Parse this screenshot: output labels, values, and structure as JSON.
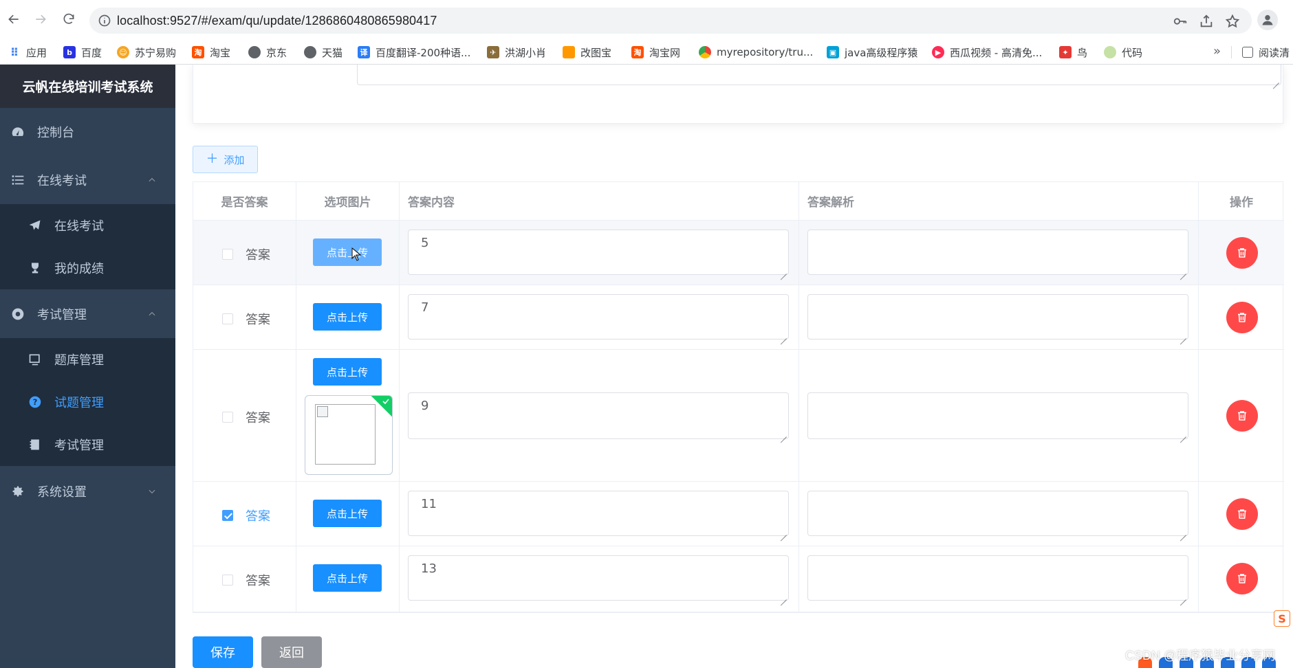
{
  "browser": {
    "url": "localhost:9527/#/exam/qu/update/1286860480865980417",
    "bookmarks": [
      {
        "label": "应用",
        "icon": "apps-grid-icon",
        "color": "#4285f4"
      },
      {
        "label": "百度",
        "icon": "baidu-paw-icon",
        "color": "#2932e1"
      },
      {
        "label": "苏宁易购",
        "icon": "suning-icon",
        "color": "#f5a623"
      },
      {
        "label": "淘宝",
        "icon": "taobao-icon",
        "color": "#ff5000"
      },
      {
        "label": "京东",
        "icon": "globe-icon",
        "color": "#5f6368"
      },
      {
        "label": "天猫",
        "icon": "globe-icon",
        "color": "#5f6368"
      },
      {
        "label": "百度翻译-200种语...",
        "icon": "baidu-translate-icon",
        "color": "#2b7cf6"
      },
      {
        "label": "洪湖小肖",
        "icon": "bird-icon",
        "color": "#8a6d3b"
      },
      {
        "label": "改图宝",
        "icon": "gaitubao-icon",
        "color": "#ff9800"
      },
      {
        "label": "淘宝网",
        "icon": "taobao-icon",
        "color": "#ff5000"
      },
      {
        "label": "myrepository/tru...",
        "icon": "chrome-icon",
        "color": "#34a853"
      },
      {
        "label": "java高级程序猿",
        "icon": "bilibili-icon",
        "color": "#00a1d6"
      },
      {
        "label": "西瓜视频 - 高清免...",
        "icon": "xigua-icon",
        "color": "#fe2c55"
      },
      {
        "label": "鸟",
        "icon": "bird-red-icon",
        "color": "#e53935"
      },
      {
        "label": "代码",
        "icon": "leaf-icon",
        "color": "#c5e1a5"
      }
    ],
    "reading_list": "阅读清"
  },
  "sidebar": {
    "title": "云帆在线培训考试系统",
    "items": [
      {
        "label": "控制台",
        "icon": "dashboard-icon"
      },
      {
        "label": "在线考试",
        "icon": "list-icon"
      },
      {
        "label": "在线考试",
        "icon": "paper-plane-icon"
      },
      {
        "label": "我的成绩",
        "icon": "trophy-icon"
      },
      {
        "label": "考试管理",
        "icon": "settings-wheel-icon"
      },
      {
        "label": "题库管理",
        "icon": "monitor-icon"
      },
      {
        "label": "试题管理",
        "icon": "question-circle-icon"
      },
      {
        "label": "考试管理",
        "icon": "notebook-icon"
      },
      {
        "label": "系统设置",
        "icon": "gear-icon"
      }
    ]
  },
  "toolbar": {
    "add_label": "添加"
  },
  "table": {
    "headers": [
      "是否答案",
      "选项图片",
      "答案内容",
      "答案解析",
      "操作"
    ],
    "checkbox_label": "答案",
    "upload_label": "点击上传",
    "rows": [
      {
        "is_answer": false,
        "content": "5",
        "analysis": "",
        "has_image": false
      },
      {
        "is_answer": false,
        "content": "7",
        "analysis": "",
        "has_image": false
      },
      {
        "is_answer": false,
        "content": "9",
        "analysis": "",
        "has_image": true
      },
      {
        "is_answer": true,
        "content": "11",
        "analysis": "",
        "has_image": false
      },
      {
        "is_answer": false,
        "content": "13",
        "analysis": "",
        "has_image": false
      }
    ]
  },
  "actions": {
    "save": "保存",
    "back": "返回"
  },
  "watermark": "CSDN @程序猿毕业分享网",
  "badge": "S",
  "colors": {
    "primary": "#1890ff",
    "danger": "#ff4949",
    "success": "#13ce66",
    "sidebar": "#304156"
  }
}
